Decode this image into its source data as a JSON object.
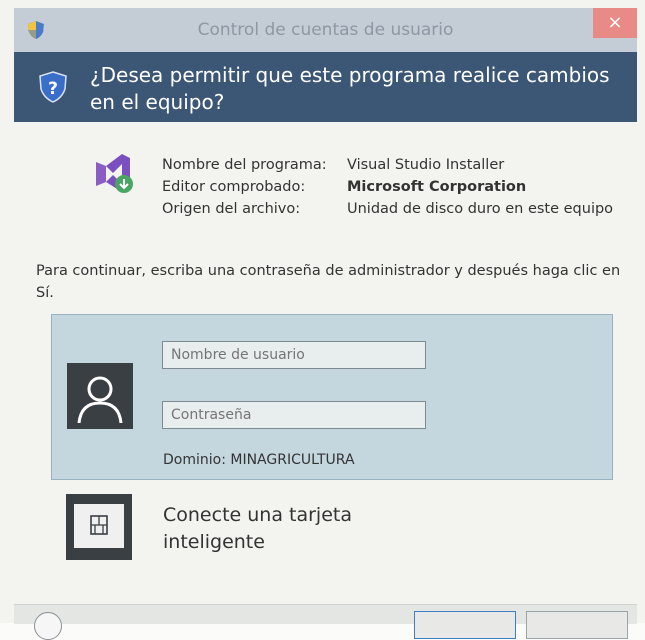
{
  "window": {
    "title": "Control de cuentas de usuario",
    "close_label": "×"
  },
  "header": {
    "question": "¿Desea permitir que este programa realice cambios en el equipo?"
  },
  "program_info": {
    "labels": [
      "Nombre del programa:",
      "Editor comprobado:",
      "Origen del archivo:"
    ],
    "values": [
      "Visual Studio Installer",
      "Microsoft Corporation",
      "Unidad de disco duro en este equipo"
    ]
  },
  "instruction": "Para continuar, escriba una contraseña de administrador y después haga clic en Sí.",
  "credentials": {
    "username_placeholder": "Nombre de usuario",
    "password_placeholder": "Contraseña",
    "domain": "Dominio: MINAGRICULTURA"
  },
  "smartcard": {
    "label": "Conecte una tarjeta inteligente"
  },
  "colors": {
    "header_bg": "#3c5675",
    "titlebar_bg": "#c4ccd6",
    "close_bg": "#e88a86",
    "credential_panel_bg": "#c4d7df",
    "vs_purple": "#8a5cc4"
  },
  "icons": [
    "shield-icon",
    "uac-question-shield-icon",
    "visual-studio-installer-icon",
    "user-avatar-icon",
    "smartcard-icon"
  ]
}
